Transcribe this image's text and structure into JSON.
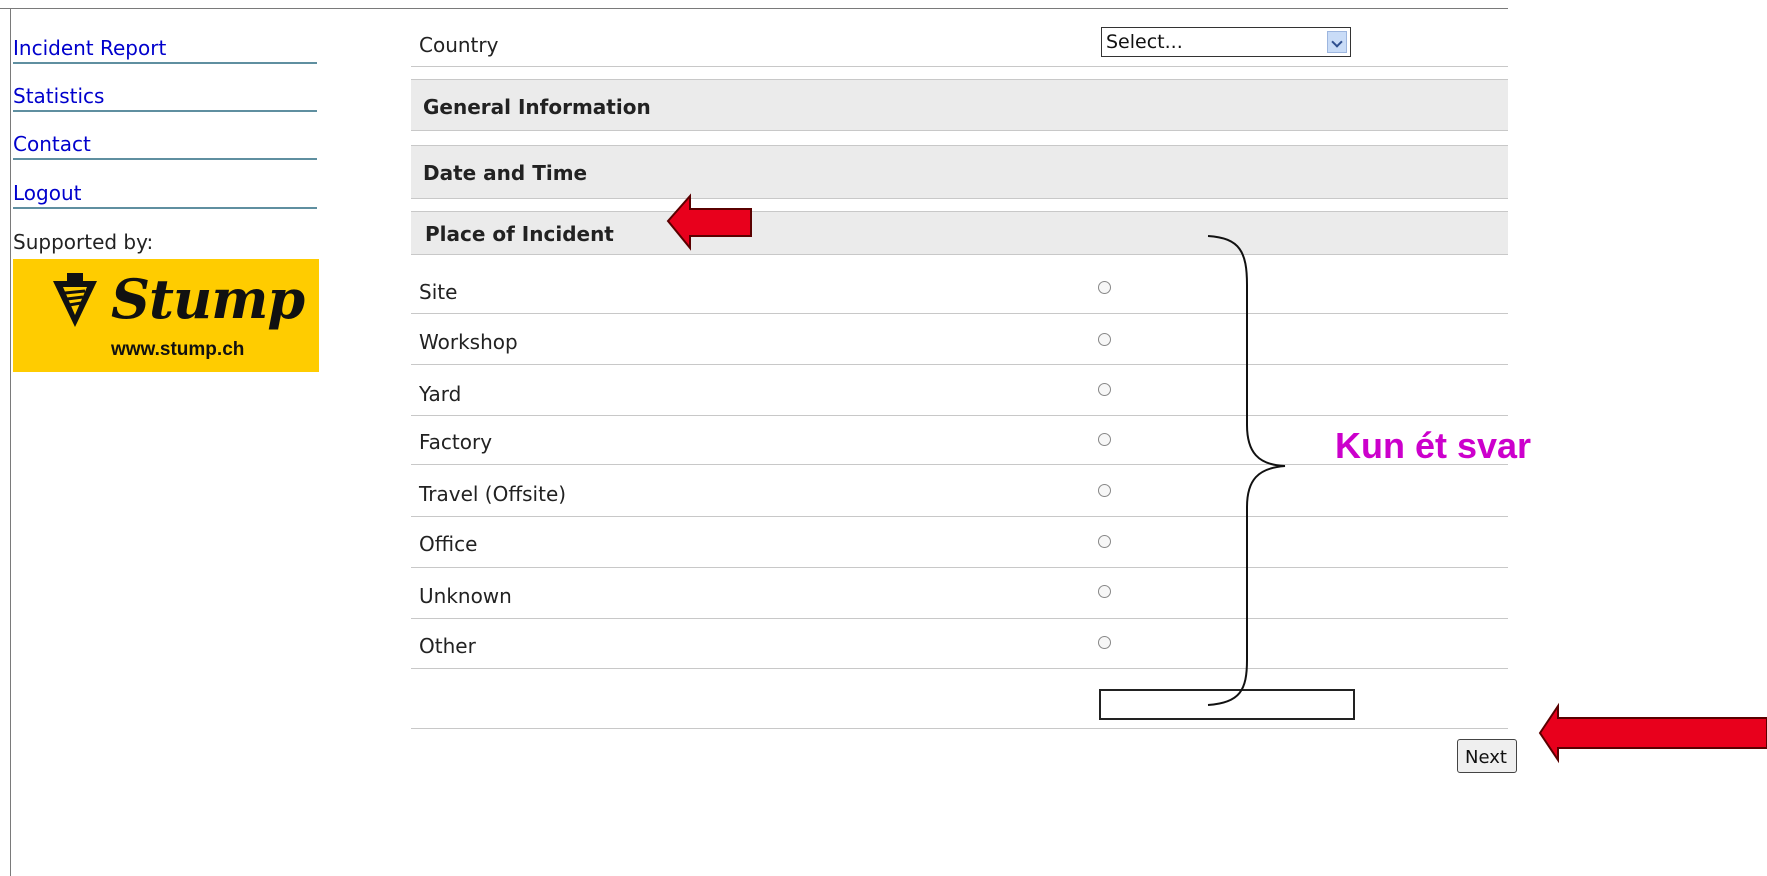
{
  "sidebar": {
    "items": [
      {
        "label": "Incident Report"
      },
      {
        "label": "Statistics"
      },
      {
        "label": "Contact"
      },
      {
        "label": "Logout"
      }
    ],
    "supported_by": "Supported by:",
    "logo": {
      "brand": "Stump",
      "url": "www.stump.ch",
      "color": "#ffcc00"
    }
  },
  "form": {
    "country_label": "Country",
    "country_select_value": "Select...",
    "sections": [
      "General Information",
      "Date and Time",
      "Place of Incident"
    ],
    "place_options": [
      "Site",
      "Workshop",
      "Yard",
      "Factory",
      "Travel (Offsite)",
      "Office",
      "Unknown",
      "Other"
    ],
    "other_text_value": "",
    "next_label": "Next"
  },
  "annotation": {
    "text": "Kun ét svar",
    "text_color": "#cc00cc",
    "arrow_color": "#e8001c"
  }
}
